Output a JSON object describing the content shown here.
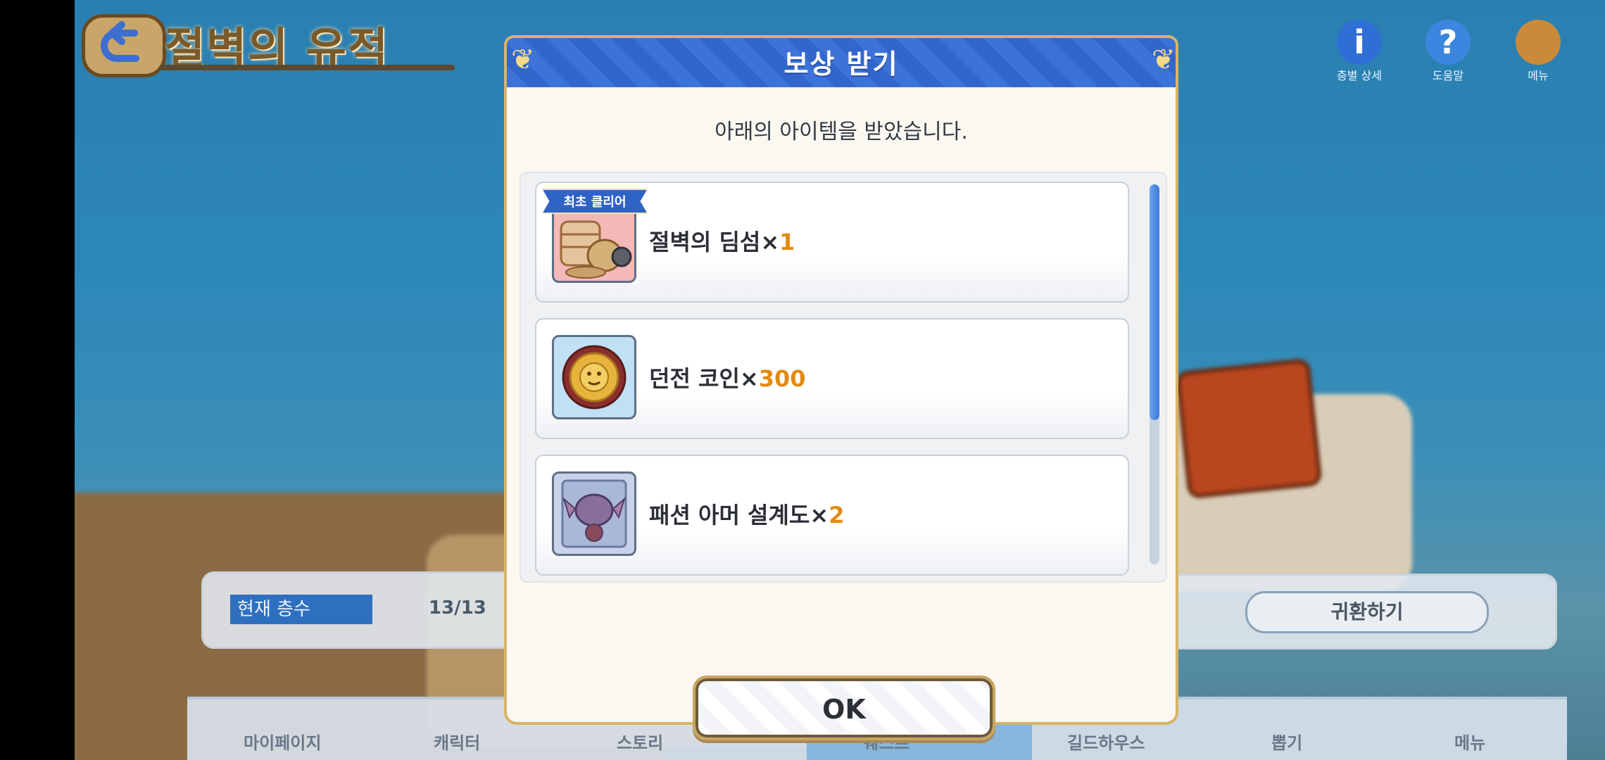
{
  "background": {
    "screen_title": "절벽의 유적",
    "top_icons": [
      {
        "name": "info-icon",
        "label": "층별 상세"
      },
      {
        "name": "help-icon",
        "label": "도움말"
      },
      {
        "name": "menu-icon",
        "label": "메뉴"
      }
    ],
    "floor_panel": {
      "label": "현재 층수",
      "value": "13/13"
    },
    "return_button_label": "귀환하기",
    "nav_items": [
      "마이페이지",
      "캐릭터",
      "스토리",
      "퀘스트",
      "길드하우스",
      "뽑기",
      "메뉴"
    ]
  },
  "dialog": {
    "title": "보상 받기",
    "message": "아래의 아이템을 받았습니다.",
    "items": [
      {
        "name": "절벽의 딤섬",
        "multiplier": "×",
        "quantity": "1",
        "badge": "최초 클리어",
        "icon": "dimsum-icon"
      },
      {
        "name": "던전 코인",
        "multiplier": "×",
        "quantity": "300",
        "badge": "",
        "icon": "dungeon-coin-icon"
      },
      {
        "name": "패션 아머 설계도",
        "multiplier": "×",
        "quantity": "2",
        "badge": "",
        "icon": "armor-blueprint-icon"
      }
    ],
    "ok_label": "OK"
  },
  "colors": {
    "header_blue": "#3366cc",
    "gold_border": "#d8b466",
    "quantity_orange": "#e48a10",
    "badge_blue": "#2f63c6"
  }
}
